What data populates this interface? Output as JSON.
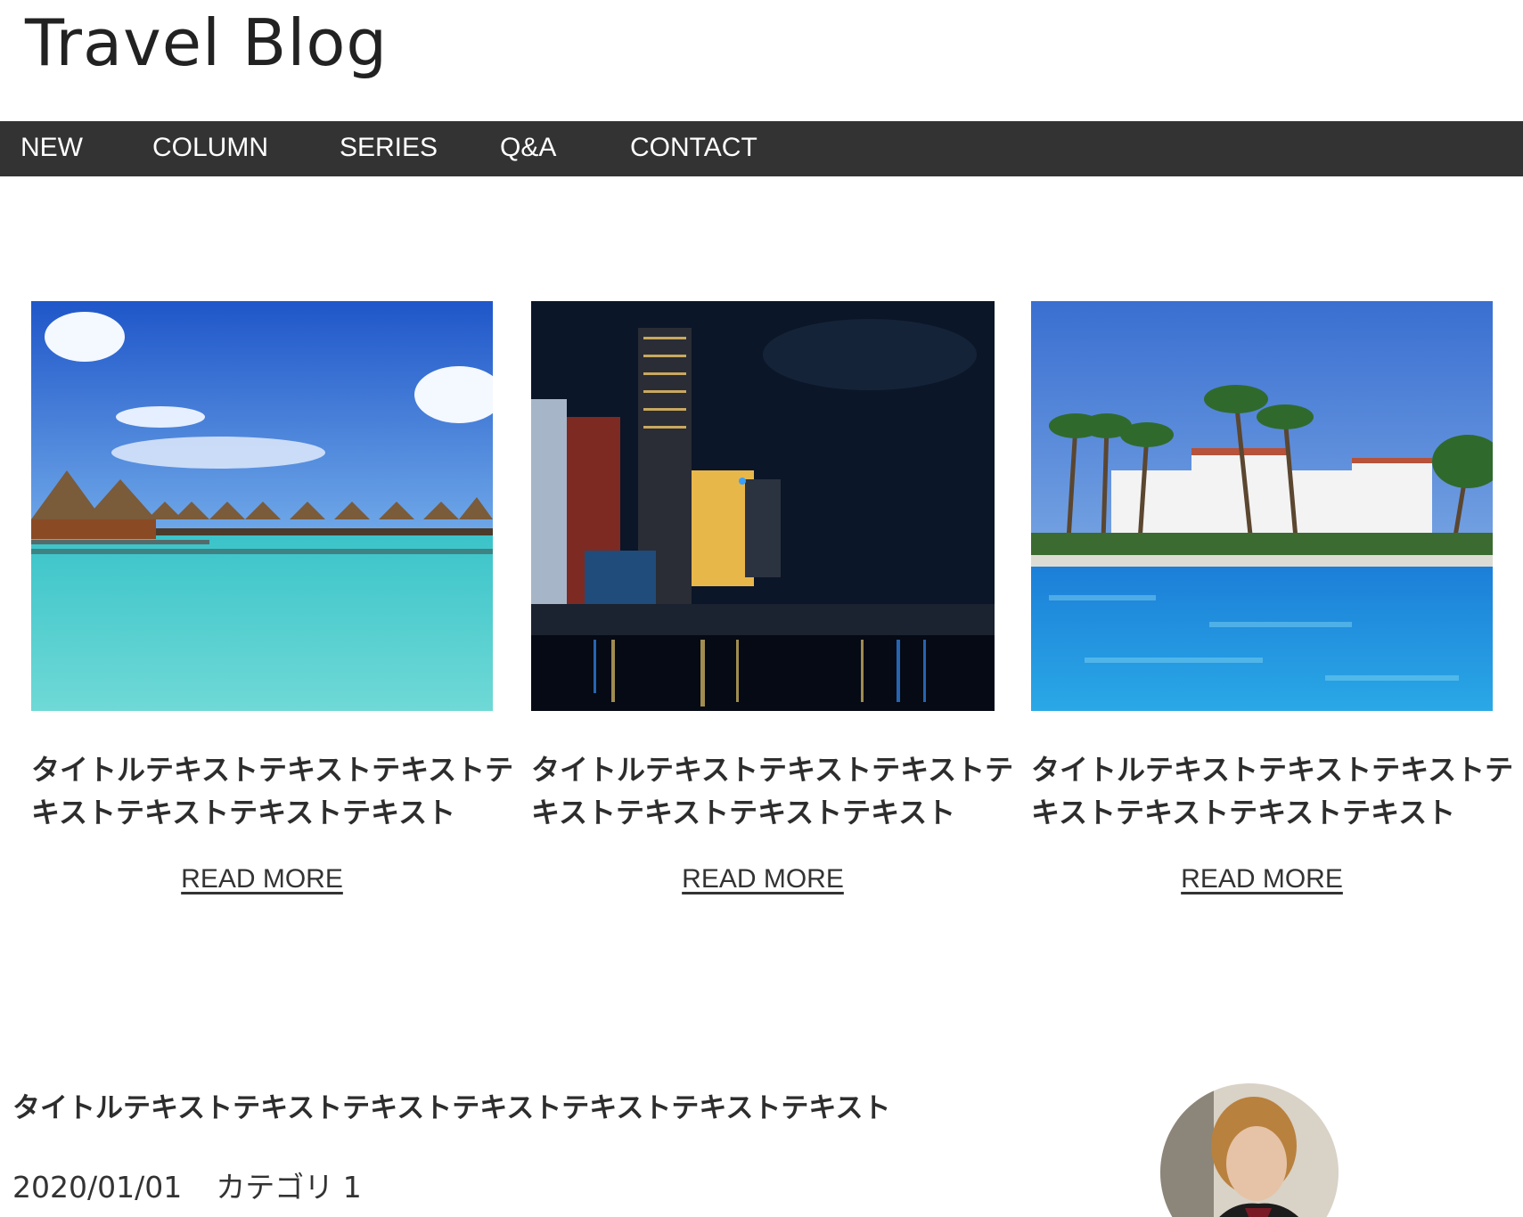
{
  "site": {
    "title": "Travel Blog"
  },
  "nav": {
    "items": [
      "NEW",
      "COLUMN",
      "SERIES",
      "Q&A",
      "CONTACT"
    ]
  },
  "cards": [
    {
      "image": "overwater-bungalows-photo",
      "title": "タイトルテキストテキストテキストテキストテキストテキストテキスト",
      "link": "READ MORE"
    },
    {
      "image": "night-city-river-photo",
      "title": "タイトルテキストテキストテキストテキストテキストテキストテキスト",
      "link": "READ MORE"
    },
    {
      "image": "resort-pool-palms-photo",
      "title": "タイトルテキストテキストテキストテキストテキストテキストテキスト",
      "link": "READ MORE"
    }
  ],
  "featured": {
    "title": "タイトルテキストテキストテキストテキストテキストテキストテキスト",
    "date": "2020/01/01",
    "category": "カテゴリ 1",
    "avatar": "author-avatar-photo"
  },
  "colors": {
    "nav_bg": "#333333",
    "text": "#2d2d2d"
  }
}
